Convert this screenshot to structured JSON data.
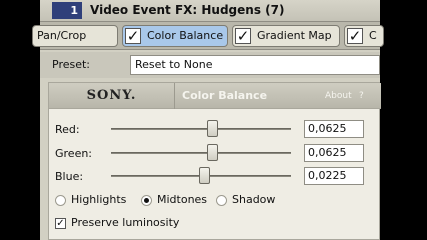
{
  "window": {
    "number": "1",
    "title": "Video Event FX: Hudgens (7)"
  },
  "tabs": [
    {
      "label": "Pan/Crop",
      "checked": false,
      "active": false
    },
    {
      "label": "Color Balance",
      "checked": true,
      "active": true
    },
    {
      "label": "Gradient Map",
      "checked": true,
      "active": false
    },
    {
      "label": "C",
      "checked": true,
      "active": false
    }
  ],
  "preset": {
    "label": "Preset:",
    "value": "Reset to None"
  },
  "plugin": {
    "brand": "SONY.",
    "name": "Color Balance",
    "about": "About",
    "help": "?"
  },
  "sliders": [
    {
      "label": "Red:",
      "value": "0,0625",
      "level": 0.5625
    },
    {
      "label": "Green:",
      "value": "0,0625",
      "level": 0.5625
    },
    {
      "label": "Blue:",
      "value": "0,0225",
      "level": 0.52
    }
  ],
  "tone_range": {
    "options": [
      "Highlights",
      "Midtones",
      "Shadow"
    ],
    "selected": "Midtones"
  },
  "preserve": {
    "label": "Preserve luminosity",
    "checked": true
  }
}
